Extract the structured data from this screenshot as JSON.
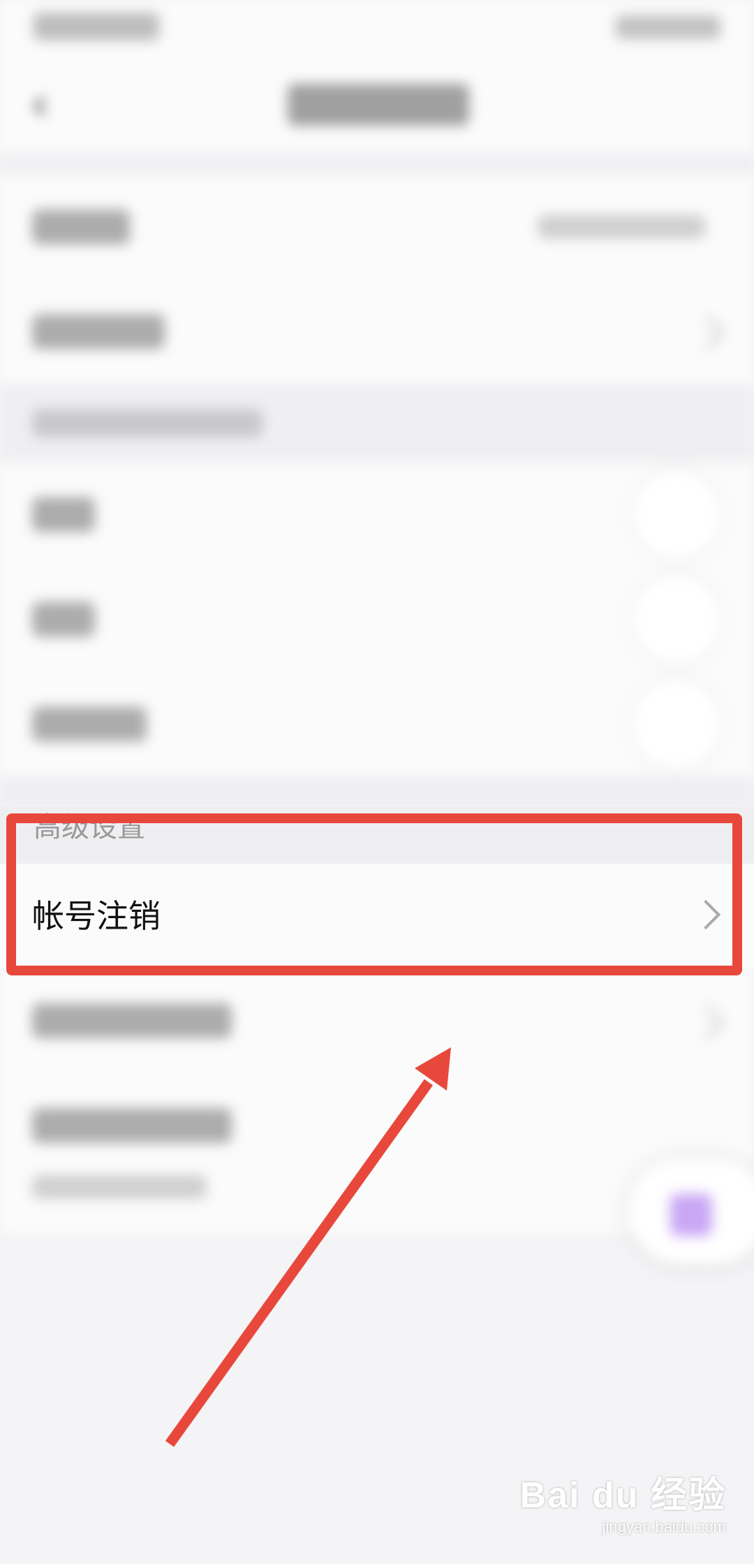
{
  "section_header": {
    "label": "高级设置"
  },
  "account_cancel": {
    "label": "帐号注销"
  },
  "annotation": {
    "box_color": "#e8483b",
    "arrow_color": "#e8483b"
  },
  "watermark": {
    "brand": "Bai du 经验",
    "domain": "jingyan.baidu.com"
  },
  "colors": {
    "background": "#f4f4f6",
    "row": "#fbfbfb",
    "accent_float": "#c9a7f5"
  }
}
